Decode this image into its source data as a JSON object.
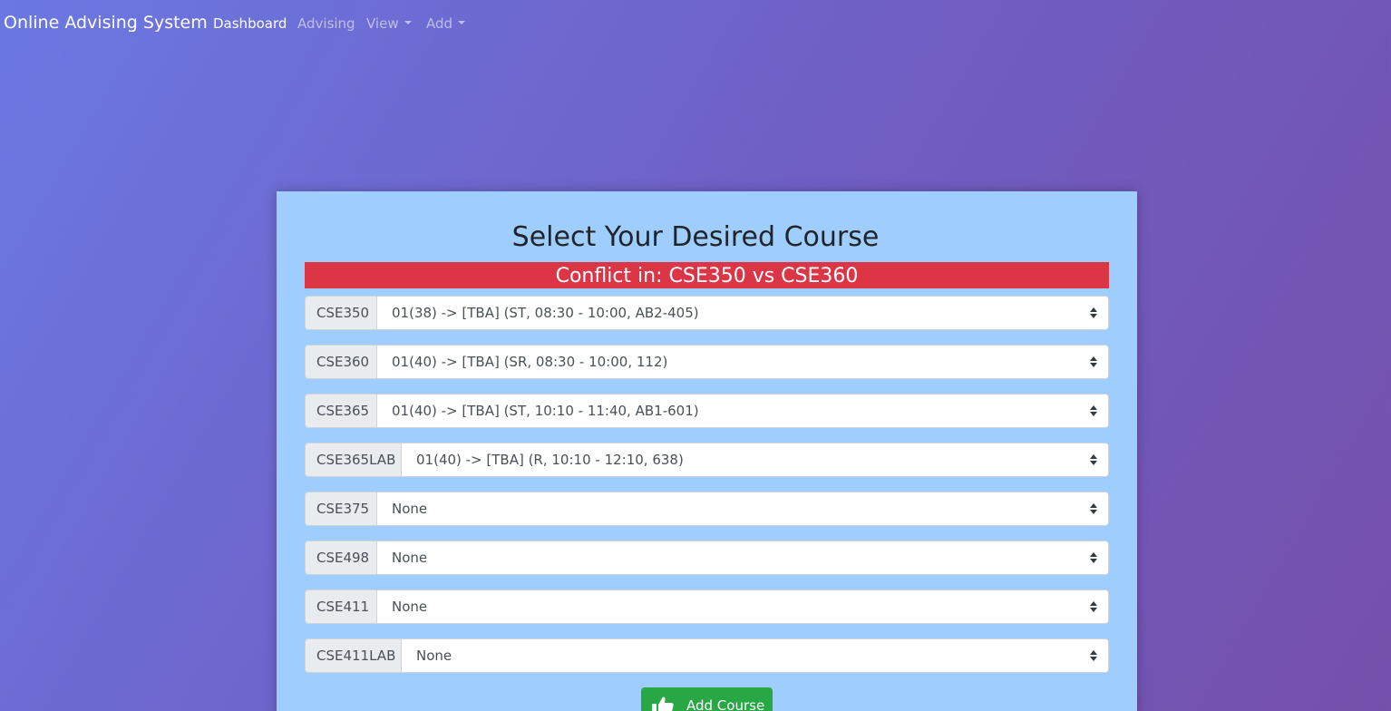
{
  "nav": {
    "brand": "Online Advising System",
    "links": [
      {
        "label": "Dashboard"
      },
      {
        "label": "Advising"
      },
      {
        "label": "View"
      },
      {
        "label": "Add"
      }
    ]
  },
  "card": {
    "title": "Select Your Desired Course",
    "conflict_text": "Conflict in: CSE350 vs CSE360",
    "courses": [
      {
        "code": "CSE350",
        "selected": "01(38) -> [TBA] (ST, 08:30 - 10:00, AB2-405)"
      },
      {
        "code": "CSE360",
        "selected": "01(40) -> [TBA] (SR, 08:30 - 10:00, 112)"
      },
      {
        "code": "CSE365",
        "selected": "01(40) -> [TBA] (ST, 10:10 - 11:40, AB1-601)"
      },
      {
        "code": "CSE365LAB",
        "selected": "01(40) -> [TBA] (R, 10:10 - 12:10, 638)"
      },
      {
        "code": "CSE375",
        "selected": "None"
      },
      {
        "code": "CSE498",
        "selected": "None"
      },
      {
        "code": "CSE411",
        "selected": "None"
      },
      {
        "code": "CSE411LAB",
        "selected": "None"
      }
    ],
    "add_button_label": "Add Course",
    "add_button_icon": "thumbs-up-icon"
  },
  "colors": {
    "card_bg": "#9fcdfd",
    "conflict_bg": "#dc3545",
    "button_bg": "#28a745"
  }
}
